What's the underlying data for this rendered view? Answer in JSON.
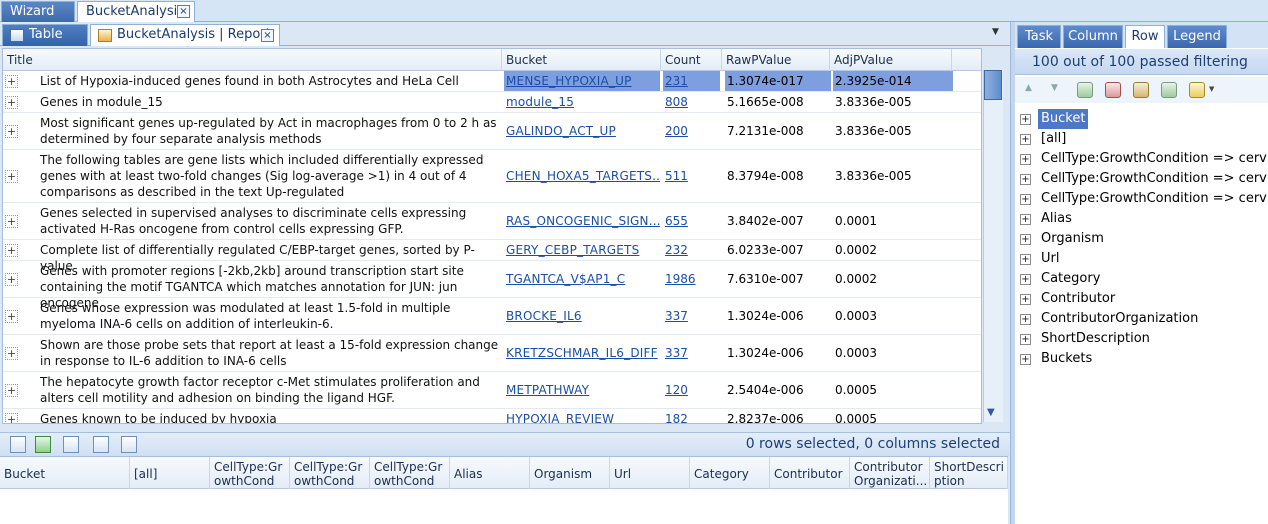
{
  "top_tabs": [
    {
      "label": "Wizard"
    },
    {
      "label": "BucketAnalysis"
    }
  ],
  "close_glyph": "×",
  "sub_tabs": [
    {
      "label": "Table"
    },
    {
      "label": "BucketAnalysis | Report"
    }
  ],
  "grid": {
    "columns": [
      "Title",
      "Bucket",
      "Count",
      "RawPValue",
      "AdjPValue"
    ],
    "rows": [
      {
        "title": "List of Hypoxia-induced genes found in both Astrocytes and HeLa Cell",
        "bucket": "MENSE_HYPOXIA_UP",
        "count": "231",
        "raw": "1.3074e-017",
        "adj": "2.3925e-014"
      },
      {
        "title": "Genes in module_15",
        "bucket": "module_15",
        "count": "808",
        "raw": "5.1665e-008",
        "adj": "3.8336e-005"
      },
      {
        "title": "Most significant genes up-regulated by Act in macrophages from 0 to 2 h as determined by four separate analysis methods",
        "bucket": "GALINDO_ACT_UP",
        "count": "200",
        "raw": "7.2131e-008",
        "adj": "3.8336e-005"
      },
      {
        "title": "The following tables are gene lists which included differentially expressed genes with at least two-fold changes (Sig log-average >1) in 4 out of 4 comparisons as described in the text Up-regulated",
        "bucket": "CHEN_HOXA5_TARGETS...",
        "count": "511",
        "raw": "8.3794e-008",
        "adj": "3.8336e-005"
      },
      {
        "title": "Genes selected in supervised analyses to discriminate cells expressing activated H-Ras oncogene from control cells expressing GFP.",
        "bucket": "RAS_ONCOGENIC_SIGN...",
        "count": "655",
        "raw": "3.8402e-007",
        "adj": "0.0001"
      },
      {
        "title": "Complete list of differentially regulated C/EBP-target genes, sorted by P-value",
        "bucket": "GERY_CEBP_TARGETS",
        "count": "232",
        "raw": "6.0233e-007",
        "adj": "0.0002"
      },
      {
        "title": "Genes with promoter regions [-2kb,2kb] around transcription start site containing the motif TGANTCA which matches annotation for JUN: jun oncogene",
        "bucket": "TGANTCA_V$AP1_C",
        "count": "1986",
        "raw": "7.6310e-007",
        "adj": "0.0002"
      },
      {
        "title": "Genes whose expression was modulated at least 1.5-fold in multiple myeloma INA-6 cells on addition of interleukin-6.",
        "bucket": "BROCKE_IL6",
        "count": "337",
        "raw": "1.3024e-006",
        "adj": "0.0003"
      },
      {
        "title": "Shown are those probe sets that report at least a 15-fold expression change in response to IL-6 addition to INA-6 cells",
        "bucket": "KRETZSCHMAR_IL6_DIFF",
        "count": "337",
        "raw": "1.3024e-006",
        "adj": "0.0003"
      },
      {
        "title": "The hepatocyte growth factor receptor c-Met stimulates proliferation and alters cell motility and adhesion on binding the ligand HGF.",
        "bucket": "METPATHWAY",
        "count": "120",
        "raw": "2.5404e-006",
        "adj": "0.0005"
      },
      {
        "title": "Genes known to be induced by hypoxia",
        "bucket": "HYPOXIA_REVIEW",
        "count": "182",
        "raw": "2.8237e-006",
        "adj": "0.0005"
      }
    ]
  },
  "selection_status": "0 rows selected, 0 columns selected",
  "bottom_columns": [
    "Bucket",
    "[all]",
    "CellType:GrowthCondi...",
    "CellType:GrowthCondi...",
    "CellType:GrowthCondi...",
    "Alias",
    "Organism",
    "Url",
    "Category",
    "Contributor",
    "Contributor Organizati...",
    "ShortDescription"
  ],
  "right_tabs": [
    "Task",
    "Column",
    "Row",
    "Legend"
  ],
  "filter_info": "100 out of 100 passed filtering",
  "tree_items": [
    "Bucket",
    "[all]",
    "CellType:GrowthCondition => cervical c",
    "CellType:GrowthCondition => cervical c",
    "CellType:GrowthCondition => cervical c",
    "Alias",
    "Organism",
    "Url",
    "Category",
    "Contributor",
    "ContributorOrganization",
    "ShortDescription",
    "Buckets"
  ],
  "colors": {
    "accent": "#3e6aad",
    "link": "#1a4ea8",
    "selection": "#7d9fe0"
  }
}
